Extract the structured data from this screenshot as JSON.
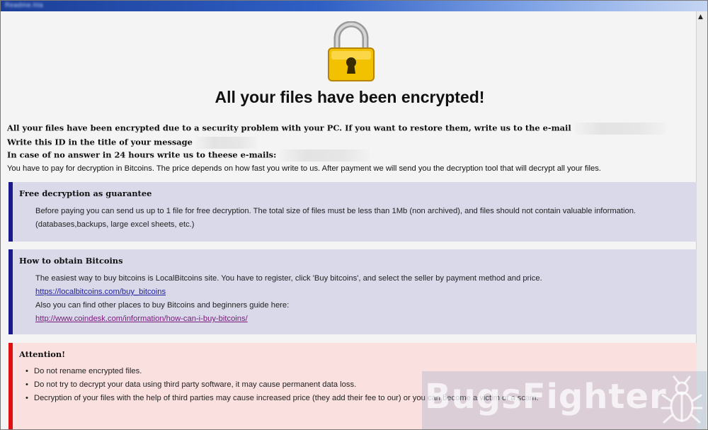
{
  "window": {
    "title": "Readme.hta"
  },
  "headline": "All your files have been encrypted!",
  "intro": {
    "line1": "All your files have been encrypted due to a security problem with your PC. If you want to restore them, write us to the e-mail",
    "line2": "Write this ID in the title of your message",
    "line3": "In case of no answer in 24 hours write us to theese e-mails:",
    "line4": "You have to pay for decryption in Bitcoins. The price depends on how fast you write to us. After payment we will send you the decryption tool that will decrypt all your files."
  },
  "free_decryption": {
    "title": "Free decryption as guarantee",
    "text1": "Before paying you can send us up to 1 file for free decryption. The total size of files must be less than 1Mb (non archived), and files should not contain valuable information.",
    "text2": "(databases,backups, large excel sheets, etc.)"
  },
  "bitcoins": {
    "title": "How to obtain Bitcoins",
    "text1": "The easiest way to buy bitcoins is LocalBitcoins site. You have to register, click 'Buy bitcoins', and select the seller by payment method and price.",
    "link1": "https://localbitcoins.com/buy_bitcoins",
    "text2": "Also you can find other places to buy Bitcoins and beginners guide here:",
    "link2": "http://www.coindesk.com/information/how-can-i-buy-bitcoins/"
  },
  "attention": {
    "title": "Attention!",
    "items": [
      "Do not rename encrypted files.",
      "Do not try to decrypt your data using third party software, it may cause permanent data loss.",
      "Decryption of your files with the help of third parties may cause increased price (they add their fee to our) or you can become a victim of a scam."
    ]
  },
  "watermark": "BugsFighter",
  "colors": {
    "info_bg": "#d9d9ea",
    "info_border": "#1a1a8c",
    "attention_bg": "#fbe0e0",
    "attention_border": "#e01010",
    "lock": "#f2c200"
  }
}
